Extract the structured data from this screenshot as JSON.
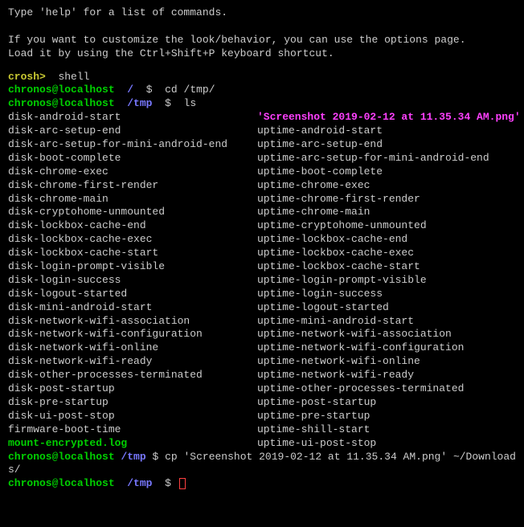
{
  "intro": {
    "line1": "Type 'help' for a list of commands.",
    "line2": "If you want to customize the look/behavior, you can use the options page.",
    "line3": "Load it by using the Ctrl+Shift+P keyboard shortcut."
  },
  "crosh_prompt": "crosh>",
  "crosh_cmd": "shell",
  "prompt1": {
    "user_host": "chronos@localhost",
    "path": "/",
    "symbol": "$",
    "cmd": "cd /tmp/"
  },
  "prompt2": {
    "user_host": "chronos@localhost",
    "path": "/tmp",
    "symbol": "$",
    "cmd": "ls"
  },
  "ls": {
    "left": [
      "disk-android-start",
      "disk-arc-setup-end",
      "disk-arc-setup-for-mini-android-end",
      "disk-boot-complete",
      "disk-chrome-exec",
      "disk-chrome-first-render",
      "disk-chrome-main",
      "disk-cryptohome-unmounted",
      "disk-lockbox-cache-end",
      "disk-lockbox-cache-exec",
      "disk-lockbox-cache-start",
      "disk-login-prompt-visible",
      "disk-login-success",
      "disk-logout-started",
      "disk-mini-android-start",
      "disk-network-wifi-association",
      "disk-network-wifi-configuration",
      "disk-network-wifi-online",
      "disk-network-wifi-ready",
      "disk-other-processes-terminated",
      "disk-post-startup",
      "disk-pre-startup",
      "disk-ui-post-stop",
      "firmware-boot-time",
      "mount-encrypted.log"
    ],
    "right": [
      "'Screenshot 2019-02-12 at 11.35.34 AM.png'",
      "uptime-android-start",
      "uptime-arc-setup-end",
      "uptime-arc-setup-for-mini-android-end",
      "uptime-boot-complete",
      "uptime-chrome-exec",
      "uptime-chrome-first-render",
      "uptime-chrome-main",
      "uptime-cryptohome-unmounted",
      "uptime-lockbox-cache-end",
      "uptime-lockbox-cache-exec",
      "uptime-lockbox-cache-start",
      "uptime-login-prompt-visible",
      "uptime-login-success",
      "uptime-logout-started",
      "uptime-mini-android-start",
      "uptime-network-wifi-association",
      "uptime-network-wifi-configuration",
      "uptime-network-wifi-online",
      "uptime-network-wifi-ready",
      "uptime-other-processes-terminated",
      "uptime-post-startup",
      "uptime-pre-startup",
      "uptime-shill-start",
      "uptime-ui-post-stop"
    ]
  },
  "prompt3": {
    "user_host": "chronos@localhost",
    "path": "/tmp",
    "symbol": "$",
    "cmd": "cp 'Screenshot 2019-02-12 at 11.35.34 AM.png' ~/Downloads/"
  },
  "prompt4": {
    "user_host": "chronos@localhost",
    "path": "/tmp",
    "symbol": "$"
  }
}
